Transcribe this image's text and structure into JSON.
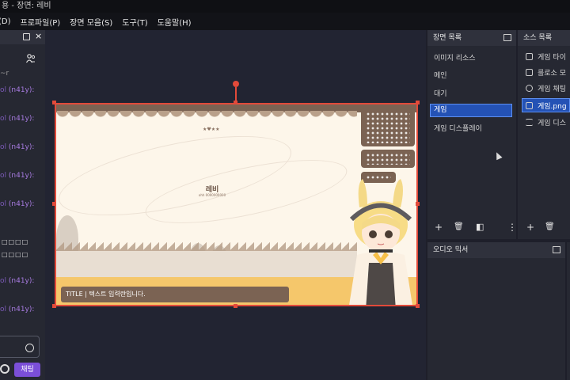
{
  "window": {
    "title": "용 - 장면: 레비"
  },
  "menu": [
    "(D)",
    "프로파일(P)",
    "장면 모음(S)",
    "도구(T)",
    "도움말(H)"
  ],
  "chat": {
    "header_close": "×",
    "name": "(n41y):",
    "lines": [
      {
        "prefix": "ol",
        "name": "(n41y):"
      },
      {
        "prefix": "ol",
        "name": "(n41y):"
      },
      {
        "prefix": "ol",
        "name": "(n41y):"
      },
      {
        "prefix": "ol",
        "name": "(n41y):"
      },
      {
        "prefix": "ol",
        "name": "(n41y):"
      },
      {
        "prefix": "ol",
        "name": "(n41y):"
      },
      {
        "prefix": "ol",
        "name": "(n41y):"
      }
    ],
    "boxes1": "□□□□",
    "boxes2": "□□□□",
    "send_button": "채팅",
    "top_text": "~r"
  },
  "canvas": {
    "character_name": "레비",
    "character_sub": "ohh 0000000000",
    "stars": "★♥★★",
    "title_bar": "TITLE  |  텍스트 입력란입니다."
  },
  "scenes_panel": {
    "title": "장면 목록",
    "items": [
      "이미지 리소스",
      "메인",
      "대기",
      "게임",
      "게임 디스플레이"
    ],
    "selected": "게임"
  },
  "sources_panel": {
    "title": "소스 목록",
    "items": [
      "게임 타이",
      "룰로소 모",
      "게임 채팅",
      "게임.png",
      "게임 디스"
    ],
    "selected": "게임.png"
  },
  "audio_panel": {
    "title": "오디오 믹서"
  },
  "toolbar": {
    "add": "+",
    "remove": "🗑",
    "filter": "◧",
    "more": "⋮"
  },
  "colors": {
    "accent": "#2452b5",
    "selection": "#e24a3a",
    "chat_btn": "#7b4fd8"
  }
}
